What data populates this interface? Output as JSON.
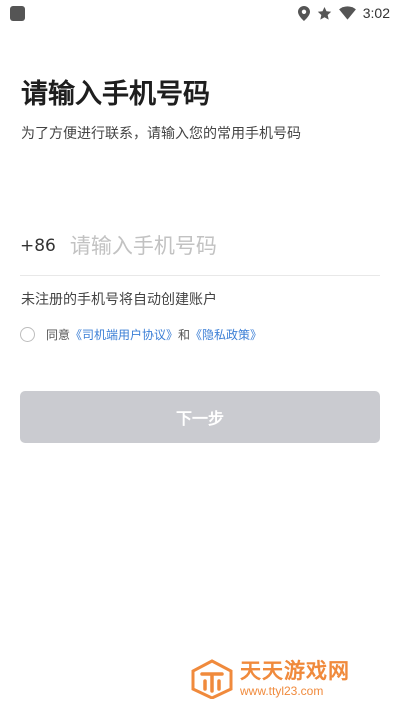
{
  "status_bar": {
    "time": "3:02",
    "icons": [
      "location-icon",
      "star-icon",
      "wifi-icon"
    ]
  },
  "header": {
    "title": "请输入手机号码",
    "subtitle": "为了方便进行联系，请输入您的常用手机号码"
  },
  "phone": {
    "country_code": "+86",
    "placeholder": "请输入手机号码",
    "value": ""
  },
  "hint": "未注册的手机号将自动创建账户",
  "agreement": {
    "prefix": "同意",
    "link1": "《司机端用户协议》",
    "conjunction": "和",
    "link2": "《隐私政策》",
    "checked": false
  },
  "next_button": {
    "label": "下一步",
    "enabled": false
  },
  "watermark": {
    "title": "天天游戏网",
    "url": "www.ttyl23.com"
  },
  "colors": {
    "link": "#3c7fd6",
    "button_disabled": "#cacbd0",
    "watermark": "#f08a3c"
  }
}
